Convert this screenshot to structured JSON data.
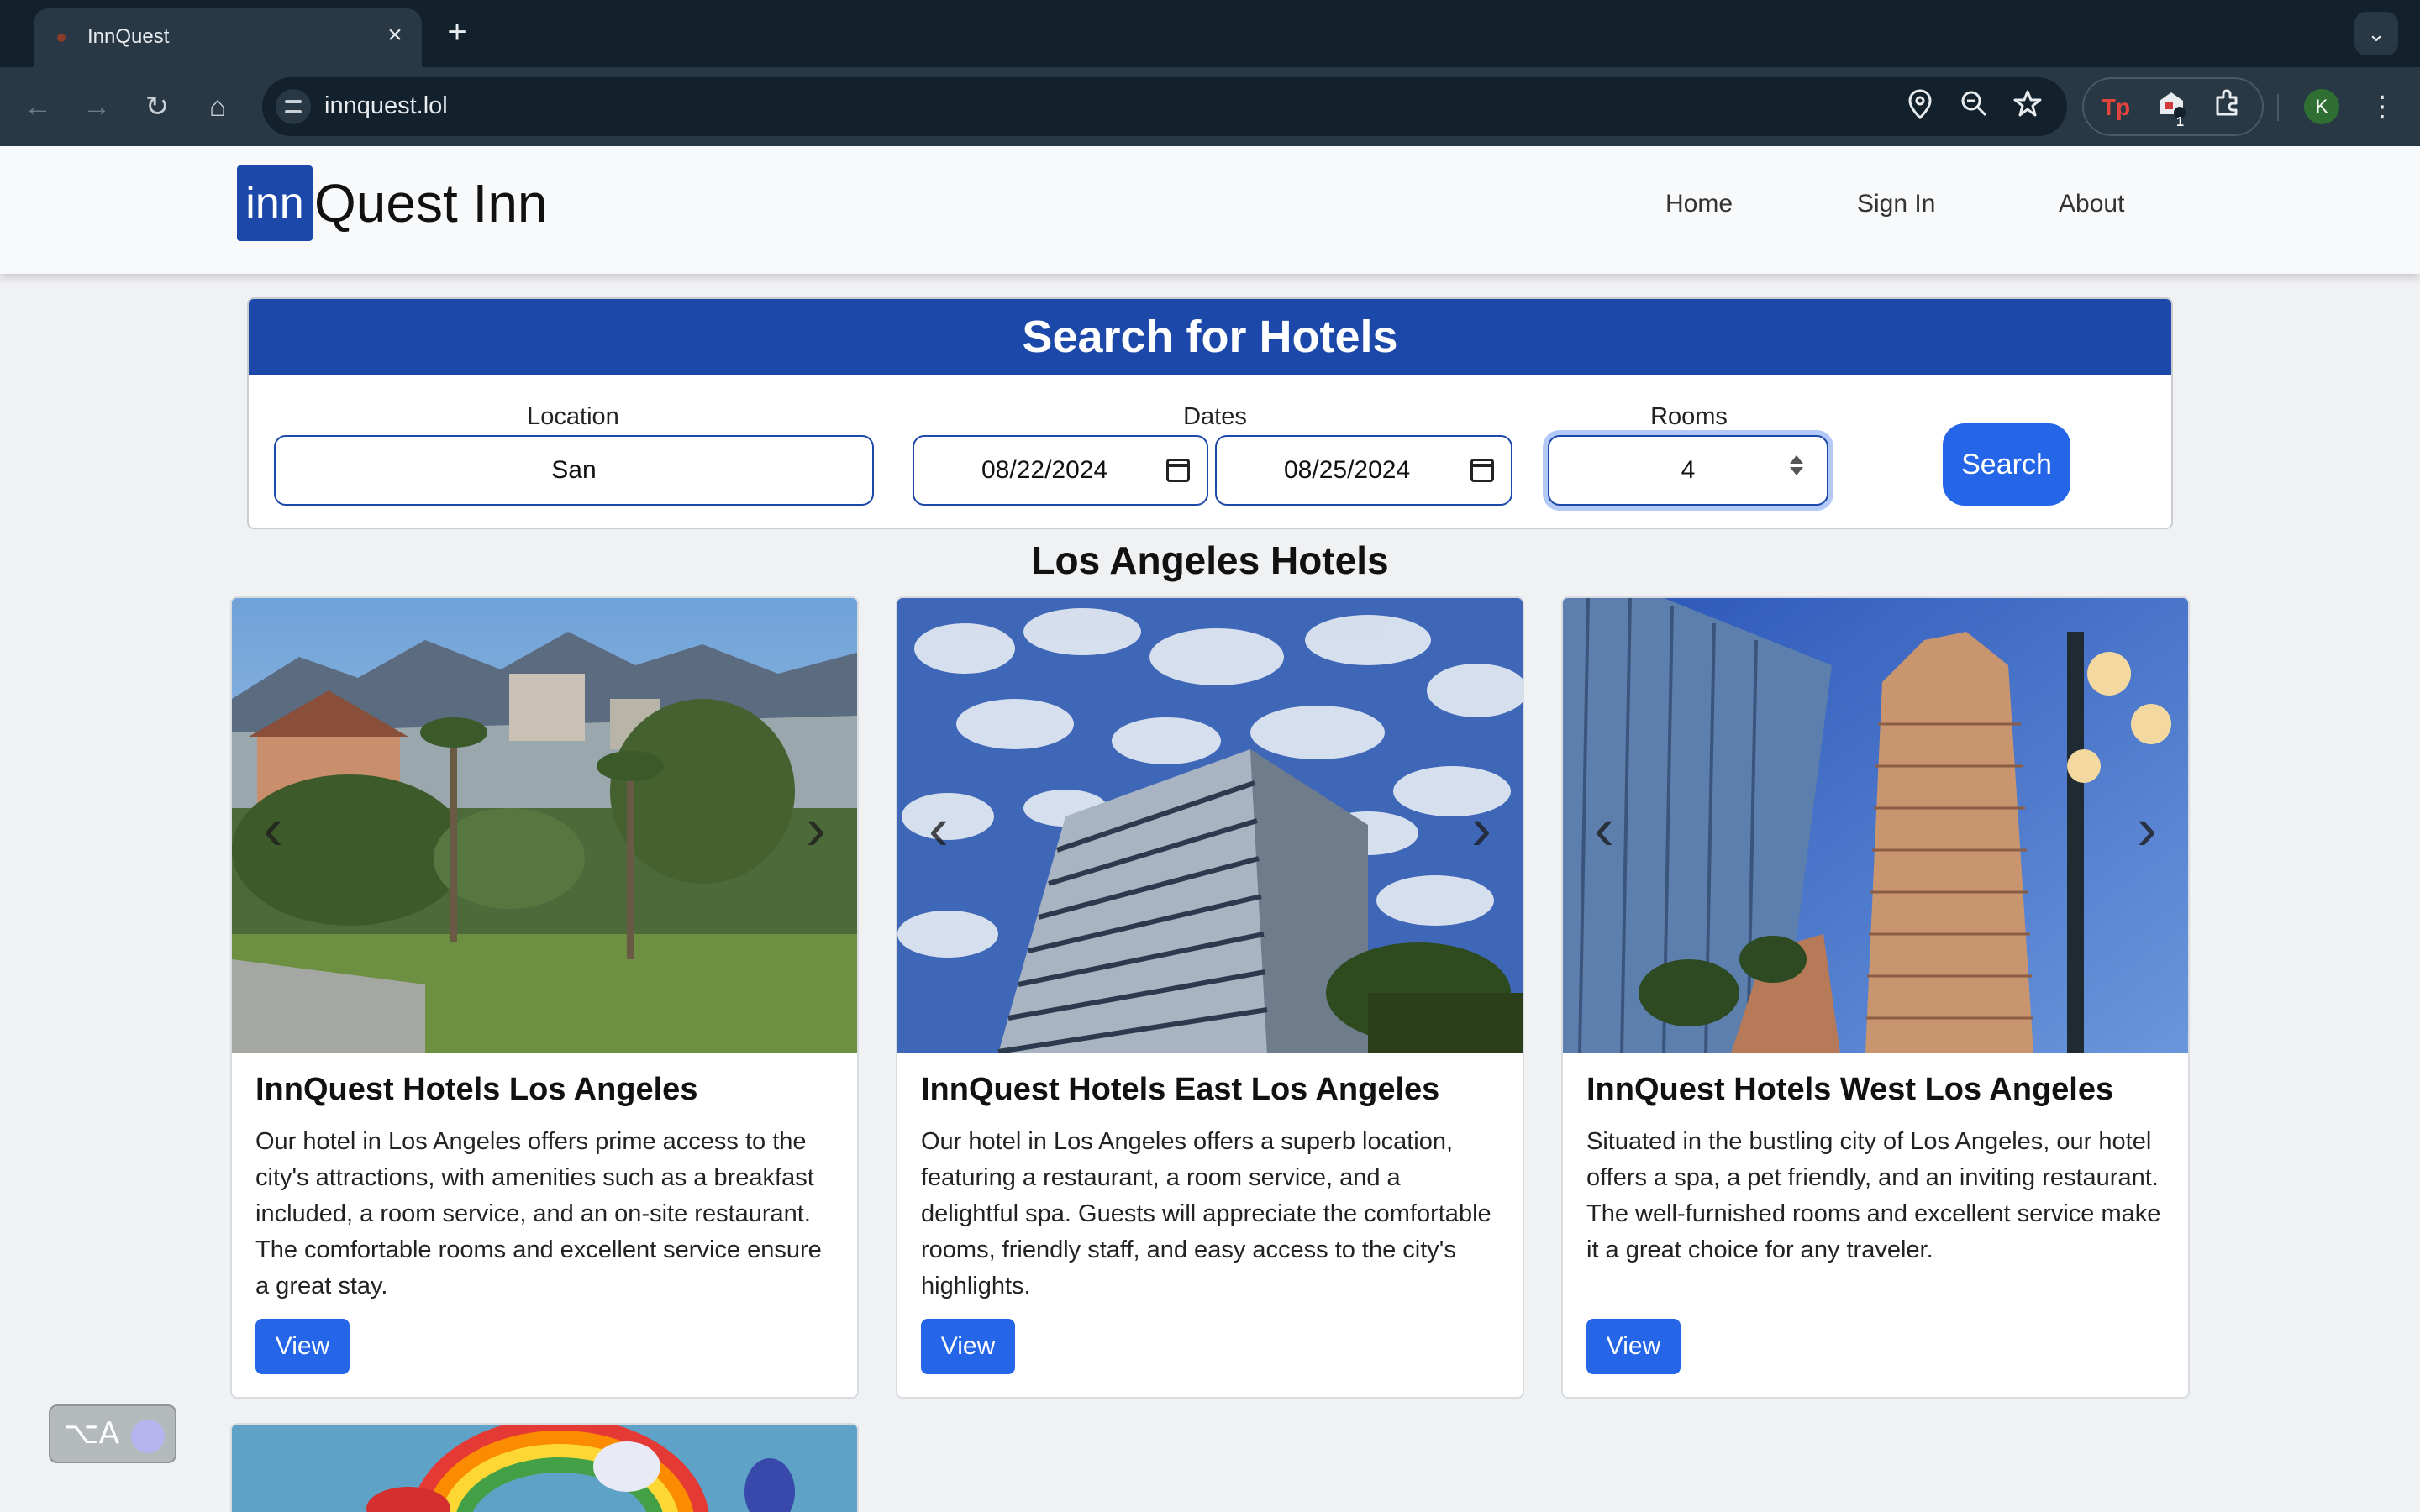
{
  "browser": {
    "tab_title": "InnQuest",
    "tab_close": "×",
    "new_tab": "+",
    "tab_menu": "⌄",
    "url": "innquest.lol",
    "nav_back": "←",
    "nav_forward": "→",
    "nav_reload": "↻",
    "nav_home": "⌂",
    "extension_badge": "1",
    "avatar_initial": "K",
    "menu": "⋮"
  },
  "site": {
    "logo_box": "inn",
    "logo_text": "Quest Inn",
    "nav": [
      "Home",
      "Sign In",
      "About"
    ]
  },
  "search": {
    "heading": "Search for Hotels",
    "location_label": "Location",
    "location_value": "San",
    "dates_label": "Dates",
    "checkin_value": "08/22/2024",
    "checkout_value": "08/25/2024",
    "rooms_label": "Rooms",
    "rooms_value": "4",
    "button_label": "Search"
  },
  "results": {
    "title": "Los Angeles Hotels",
    "hotels": [
      {
        "name": "InnQuest Hotels Los Angeles",
        "description": "Our hotel in Los Angeles offers prime access to the city's attractions, with amenities such as a breakfast included, a room service, and an on-site restaurant. The comfortable rooms and excellent service ensure a great stay.",
        "button": "View"
      },
      {
        "name": "InnQuest Hotels East Los Angeles",
        "description": "Our hotel in Los Angeles offers a superb location, featuring a restaurant, a room service, and a delightful spa. Guests will appreciate the comfortable rooms, friendly staff, and easy access to the city's highlights.",
        "button": "View"
      },
      {
        "name": "InnQuest Hotels West Los Angeles",
        "description": "Situated in the bustling city of Los Angeles, our hotel offers a spa, a pet friendly, and an inviting restaurant. The well-furnished rooms and excellent service make it a great choice for any traveler.",
        "button": "View"
      }
    ]
  },
  "widget": {
    "text": "⌥A"
  },
  "colors": {
    "brand": "#1c48a9",
    "button": "#2566e8"
  }
}
